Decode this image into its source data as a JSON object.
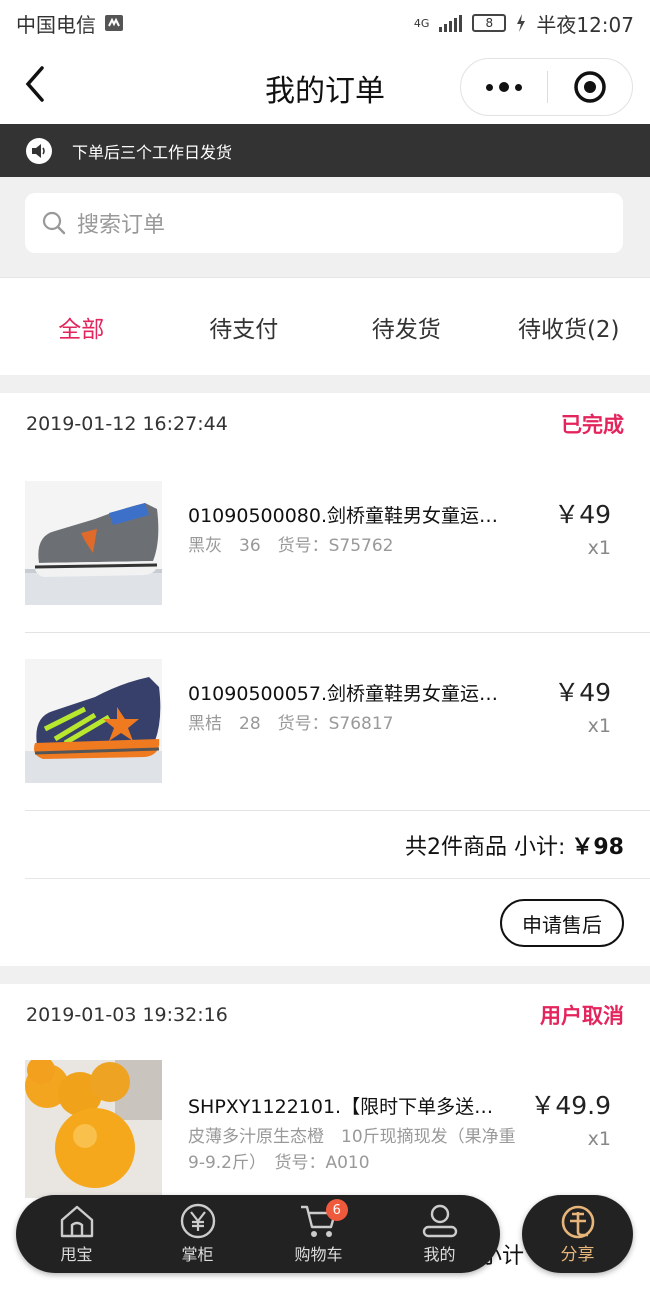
{
  "status_bar": {
    "carrier": "中国电信",
    "network": "4G",
    "battery": "8",
    "time": "半夜12:07"
  },
  "nav": {
    "title": "我的订单"
  },
  "notice": {
    "text": "下单后三个工作日发货"
  },
  "search": {
    "placeholder": "搜索订单"
  },
  "tabs": [
    {
      "label": "全部",
      "active": true
    },
    {
      "label": "待支付",
      "active": false
    },
    {
      "label": "待发货",
      "active": false
    },
    {
      "label": "待收货(2)",
      "active": false
    }
  ],
  "orders": [
    {
      "time": "2019-01-12 16:27:44",
      "status": "已完成",
      "items": [
        {
          "title": "01090500080.剑桥童鞋男女童运…",
          "spec": "黑灰　36　货号：S75762",
          "price": "￥49",
          "qty": "x1",
          "thumb_icon": "gray-sneaker-image"
        },
        {
          "title": "01090500057.剑桥童鞋男女童运…",
          "spec": "黑桔　28　货号：S76817",
          "price": "￥49",
          "qty": "x1",
          "thumb_icon": "orange-sneaker-image"
        }
      ],
      "summary_label": "共2件商品 小计:",
      "summary_total": "￥98",
      "action_label": "申请售后"
    },
    {
      "time": "2019-01-03 19:32:16",
      "status": "用户取消",
      "items": [
        {
          "title": "SHPXY1122101.【限时下单多送…",
          "spec": "皮薄多汁原生态橙　10斤现摘现发（果净重9-9.2斤）　货号：A010",
          "price": "￥49.9",
          "qty": "x1",
          "thumb_icon": "orange-fruit-image"
        }
      ],
      "partial_summary": "小计"
    }
  ],
  "tabbar": [
    {
      "label": "甩宝",
      "icon": "home-icon"
    },
    {
      "label": "掌柜",
      "icon": "yen-icon"
    },
    {
      "label": "购物车",
      "icon": "cart-icon",
      "badge": "6"
    },
    {
      "label": "我的",
      "icon": "user-icon"
    }
  ],
  "share": {
    "label": "分享",
    "icon": "share-logo-icon"
  },
  "colors": {
    "accent": "#e4245d",
    "notice_bg": "#333333",
    "tabbar_bg": "#222222",
    "share_gold": "#e7b57a",
    "badge": "#f05a3c"
  }
}
